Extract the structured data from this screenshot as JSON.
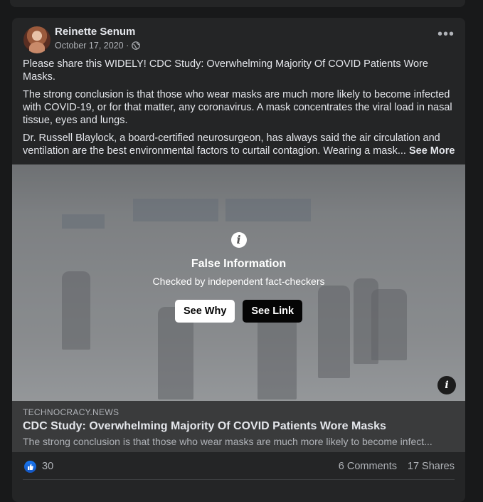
{
  "post": {
    "author": "Reinette Senum",
    "date": "October 17, 2020 ·",
    "privacy_icon": "globe-icon",
    "more_icon": "•••",
    "paragraphs": [
      "Please share this WIDELY!  CDC Study: Overwhelming Majority Of COVID Patients Wore Masks.",
      "The strong conclusion is that those who wear masks are much more likely to become infected with COVID-19, or for that matter, any coronavirus. A mask concentrates the viral load in nasal tissue, eyes and lungs.",
      "Dr. Russell Blaylock, a board-certified neurosurgeon, has always said the air circulation and ventilation are the best environmental factors to curtail contagion. Wearing a mask..."
    ],
    "see_more": "See More"
  },
  "fact_check": {
    "icon": "i",
    "title": "False Information",
    "subtitle": "Checked by independent fact-checkers",
    "see_why": "See Why",
    "see_link": "See Link",
    "corner_icon": "i"
  },
  "link_preview": {
    "domain": "TECHNOCRACY.NEWS",
    "title": "CDC Study: Overwhelming Majority Of COVID Patients Wore Masks",
    "description": "The strong conclusion is that those who wear masks are much more likely to become infect..."
  },
  "stats": {
    "likes": "30",
    "comments": "6 Comments",
    "shares": "17 Shares"
  },
  "colors": {
    "background": "#18191a",
    "card": "#242526",
    "like_blue": "#1877f2"
  }
}
